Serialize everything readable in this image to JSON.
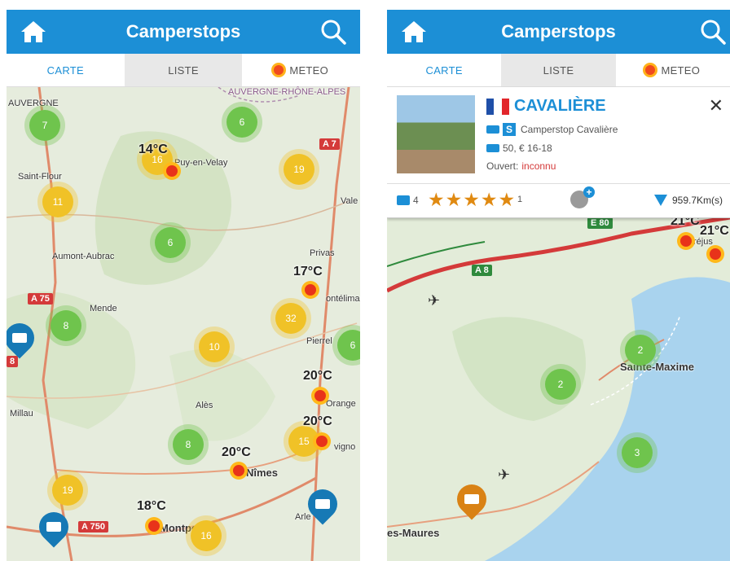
{
  "app": {
    "title": "Camperstops"
  },
  "tabs": {
    "carte": "CARTE",
    "liste": "LISTE",
    "meteo": "METEO"
  },
  "colors": {
    "header": "#1c8fd6",
    "cluster_green": "#6fc44d",
    "cluster_yellow": "#f0c227",
    "pin_blue": "#1679b5",
    "pin_orange": "#d98215",
    "road_red": "#d43a3a"
  },
  "icons": {
    "home": "home-icon",
    "search": "search-icon",
    "weather": "sun-icon",
    "camper": "camper-pin-icon",
    "close": "close-icon"
  },
  "left_map": {
    "clusters": [
      {
        "count": "7",
        "color": "green"
      },
      {
        "count": "6",
        "color": "green"
      },
      {
        "count": "16",
        "color": "yellow"
      },
      {
        "count": "19",
        "color": "yellow"
      },
      {
        "count": "11",
        "color": "yellow"
      },
      {
        "count": "6",
        "color": "green"
      },
      {
        "count": "32",
        "color": "yellow"
      },
      {
        "count": "8",
        "color": "green"
      },
      {
        "count": "10",
        "color": "yellow"
      },
      {
        "count": "6",
        "color": "green"
      },
      {
        "count": "8",
        "color": "green"
      },
      {
        "count": "15",
        "color": "yellow"
      },
      {
        "count": "19",
        "color": "yellow"
      },
      {
        "count": "16",
        "color": "yellow"
      }
    ],
    "places": [
      "AUVERGNE",
      "AUVERGNE-RHÔNE-ALPES",
      "Saint-Flour",
      "Puy-en-Velay",
      "Vale",
      "Aumont-Aubrac",
      "Privas",
      "ontélima",
      "Mende",
      "Pierrel",
      "Alès",
      "Orange",
      "Millau",
      "vigno",
      "Nîmes",
      "Montpellier",
      "Arle"
    ],
    "roads": [
      "A 7",
      "A 75",
      "A 750",
      "8"
    ],
    "temps": [
      "14°C",
      "17°C",
      "20°C",
      "20°C",
      "20°C",
      "18°C"
    ]
  },
  "right_map": {
    "clusters": [
      {
        "count": "2",
        "color": "green"
      },
      {
        "count": "2",
        "color": "green"
      },
      {
        "count": "3",
        "color": "green"
      }
    ],
    "places": [
      "Sainte-Maxime",
      "es-Maures",
      "réjus"
    ],
    "roads": [
      "E 80",
      "A 8"
    ],
    "temps": [
      "21°C",
      "21°C"
    ]
  },
  "detail": {
    "name": "CAVALIÈRE",
    "subtitle": "Camperstop Cavalière",
    "info": "50, € 16-18",
    "ouvert_label": "Ouvert:",
    "ouvert_value": "inconnu",
    "photos": "4",
    "stars": "★★★★★",
    "rating_count": "1",
    "distance": "959.7Km(s)",
    "s_badge": "S"
  }
}
